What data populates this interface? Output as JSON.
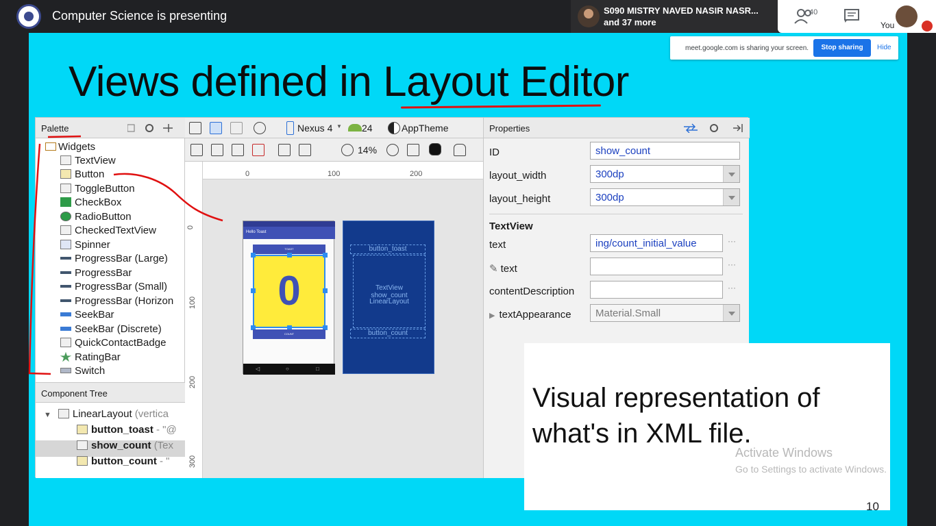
{
  "meet": {
    "presenting": "Computer Science is presenting",
    "participant_name": "S090 MISTRY NAVED NASIR NASR...",
    "participant_more": "and 37 more",
    "people_count": "40",
    "you_label": "You"
  },
  "share_bar": {
    "message": "meet.google.com is sharing your screen.",
    "stop_label": "Stop sharing",
    "hide_label": "Hide"
  },
  "slide": {
    "title": "Views defined in Layout Editor",
    "number": "10",
    "caption": "Visual representation of what's in XML file."
  },
  "studio": {
    "palette_title": "Palette",
    "widgets_folder": "Widgets",
    "widgets": [
      "TextView",
      "Button",
      "ToggleButton",
      "CheckBox",
      "RadioButton",
      "CheckedTextView",
      "Spinner",
      "ProgressBar (Large)",
      "ProgressBar",
      "ProgressBar (Small)",
      "ProgressBar (Horizon",
      "SeekBar",
      "SeekBar (Discrete)",
      "QuickContactBadge",
      "RatingBar",
      "Switch"
    ],
    "component_tree_title": "Component Tree",
    "tree": {
      "root_name": "LinearLayout",
      "root_suffix": "(vertica",
      "items": [
        {
          "name": "button_toast",
          "suffix": "- \"@"
        },
        {
          "name": "show_count",
          "suffix": "(Tex"
        },
        {
          "name": "button_count",
          "suffix": "- \""
        }
      ]
    },
    "toolbar": {
      "device": "Nexus 4",
      "api": "24",
      "theme": "AppTheme",
      "zoom": "14%"
    },
    "ruler": {
      "top_ticks": [
        "0",
        "100",
        "200"
      ],
      "left_ticks": [
        "0",
        "100",
        "200",
        "300"
      ]
    },
    "preview": {
      "app_title": "Hello Toast",
      "button_toast": "TOAST",
      "count_value": "0",
      "button_count": "COUNT"
    },
    "blueprint": {
      "button_toast": "button_toast",
      "textview_line1": "TextView",
      "textview_line2": "show_count",
      "textview_line3": "LinearLayout",
      "button_count": "button_count"
    },
    "properties": {
      "title": "Properties",
      "id_label": "ID",
      "id_value": "show_count",
      "layout_width_label": "layout_width",
      "layout_width_value": "300dp",
      "layout_height_label": "layout_height",
      "layout_height_value": "300dp",
      "section_title": "TextView",
      "text_label": "text",
      "text_value": "ing/count_initial_value",
      "tools_text_label": "text",
      "content_desc_label": "contentDescription",
      "text_appearance_label": "textAppearance",
      "text_appearance_value": "Material.Small"
    }
  },
  "windows_watermark": {
    "title": "Activate Windows",
    "subtitle": "Go to Settings to activate Windows."
  },
  "colors": {
    "slide_bg": "#00d8f7",
    "meet_bar": "#202124",
    "annotation_red": "#e01010",
    "android_indigo": "#3f51b5",
    "count_yellow": "#ffeb3b",
    "blueprint_bg": "#123a8c"
  }
}
